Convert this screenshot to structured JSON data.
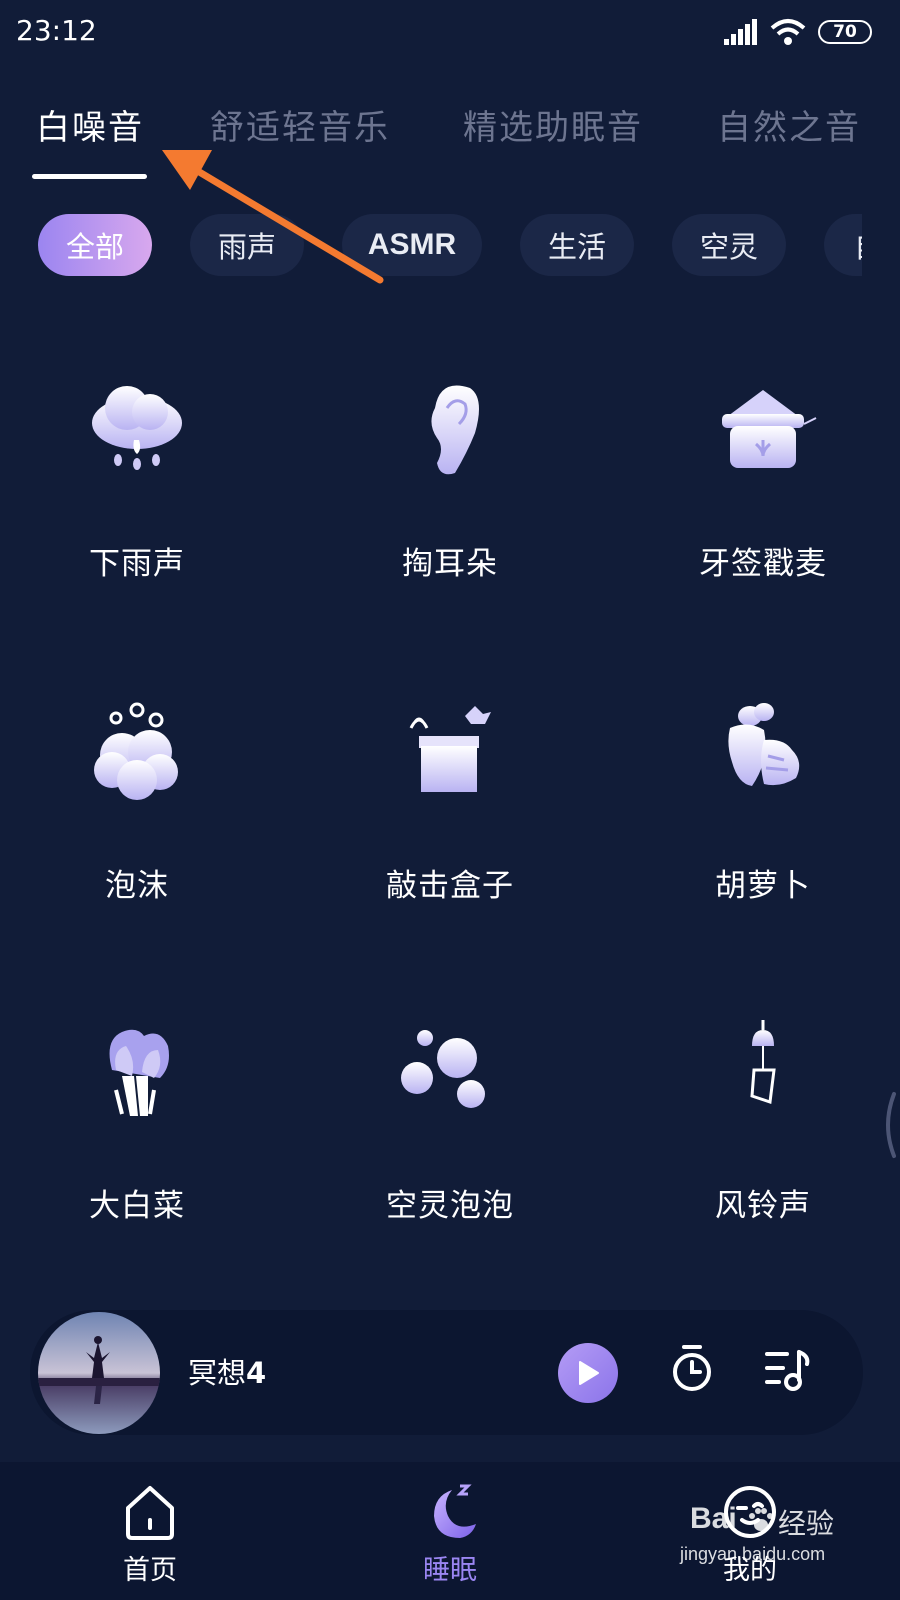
{
  "status_bar": {
    "time": "23:12",
    "battery": "70"
  },
  "main_tabs": [
    {
      "label": "白噪音",
      "active": true
    },
    {
      "label": "舒适轻音乐",
      "active": false
    },
    {
      "label": "精选助眠音",
      "active": false
    },
    {
      "label": "自然之音",
      "active": false
    }
  ],
  "chips": [
    {
      "label": "全部",
      "active": true
    },
    {
      "label": "雨声",
      "active": false
    },
    {
      "label": "ASMR",
      "active": false
    },
    {
      "label": "生活",
      "active": false
    },
    {
      "label": "空灵",
      "active": false
    },
    {
      "label": "自",
      "active": false
    }
  ],
  "sounds": [
    {
      "label": "下雨声",
      "icon": "rain-cloud-icon"
    },
    {
      "label": "掏耳朵",
      "icon": "ear-icon"
    },
    {
      "label": "牙签戳麦",
      "icon": "wheat-sack-icon"
    },
    {
      "label": "泡沫",
      "icon": "foam-icon"
    },
    {
      "label": "敲击盒子",
      "icon": "box-icon"
    },
    {
      "label": "胡萝卜",
      "icon": "carrot-icon"
    },
    {
      "label": "大白菜",
      "icon": "cabbage-icon"
    },
    {
      "label": "空灵泡泡",
      "icon": "bubbles-icon"
    },
    {
      "label": "风铃声",
      "icon": "wind-chime-icon"
    }
  ],
  "player": {
    "title": "冥想",
    "track_number": "4"
  },
  "bottom_nav": [
    {
      "label": "首页",
      "icon": "home-icon",
      "active": false
    },
    {
      "label": "睡眠",
      "icon": "moon-icon",
      "active": true
    },
    {
      "label": "我的",
      "icon": "profile-icon",
      "active": false
    }
  ],
  "watermark": {
    "brand": "Bai",
    "brand_suffix": "经验",
    "url": "jingyan.baidu.com"
  },
  "colors": {
    "background": "#111c38",
    "accent": "#9b86f3",
    "annotation": "#f47a30"
  }
}
